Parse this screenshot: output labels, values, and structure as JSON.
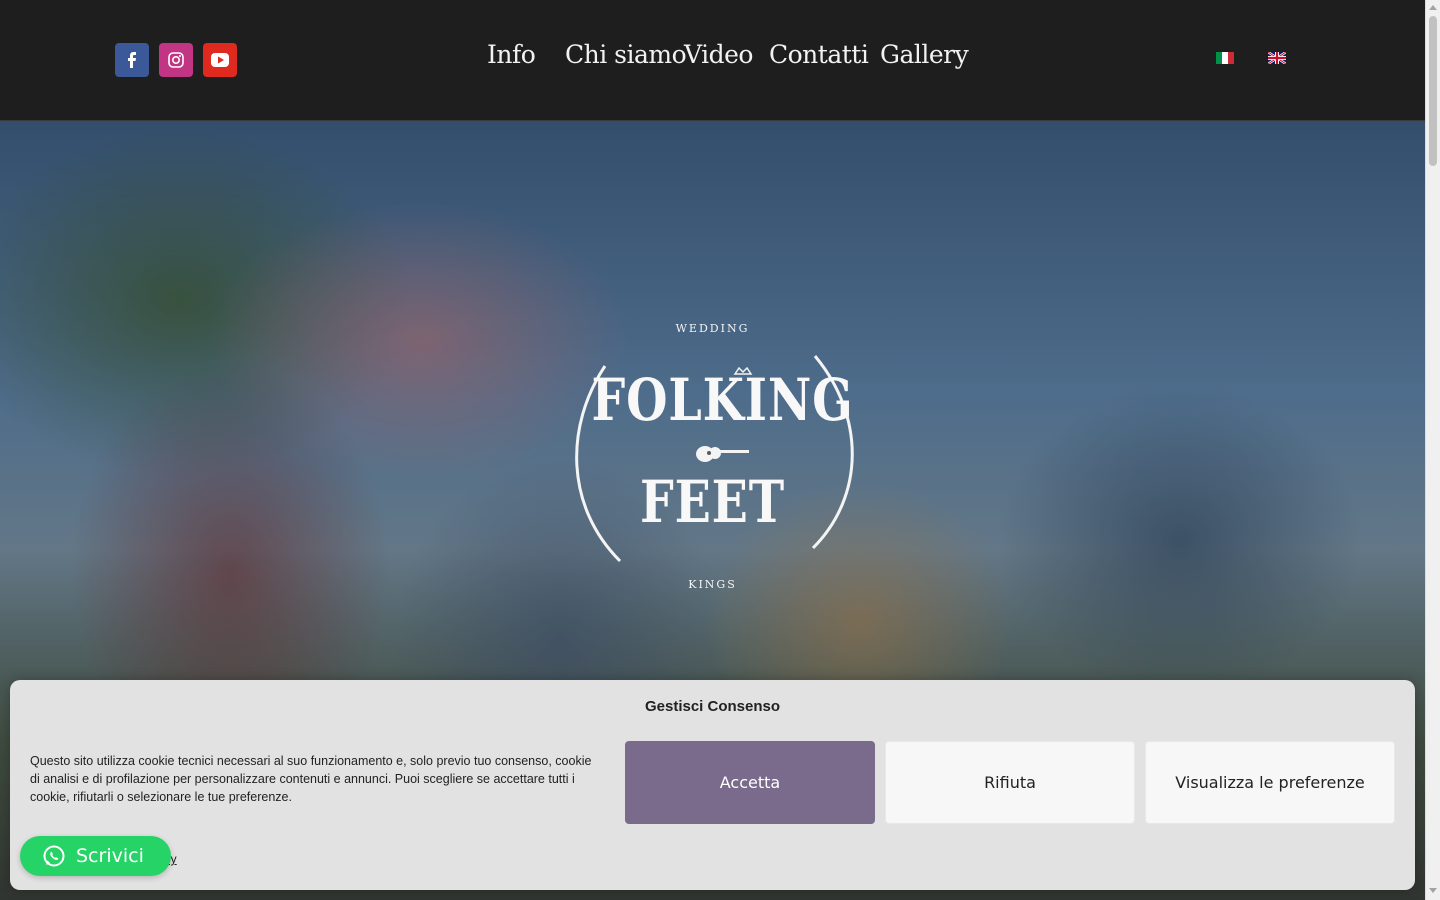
{
  "header": {
    "social": [
      {
        "name": "facebook",
        "icon": "facebook-icon",
        "color": "#3b5998"
      },
      {
        "name": "instagram",
        "icon": "instagram-icon",
        "color": "#c13584"
      },
      {
        "name": "youtube",
        "icon": "youtube-icon",
        "color": "#e02a20"
      }
    ],
    "nav": [
      "Info",
      "Chi siamo",
      "Video",
      "Contatti",
      "Gallery"
    ],
    "languages": [
      {
        "code": "it",
        "icon": "italian-flag-icon"
      },
      {
        "code": "en",
        "icon": "uk-flag-icon"
      }
    ]
  },
  "hero": {
    "logo": {
      "top": "WEDDING",
      "line1": "FOLKING",
      "line2": "FEET",
      "bottom": "KINGS"
    }
  },
  "cookie": {
    "title": "Gestisci Consenso",
    "text": "Questo sito utilizza cookie tecnici necessari al suo funzionamento e, solo previo tuo consenso, cookie di analisi e di profilazione per personalizzare contenuti e annunci. Puoi scegliere se accettare tutti i cookie, rifiutarli o selezionare le tue preferenze.",
    "link": "icy",
    "accept": "Accetta",
    "reject": "Rifiuta",
    "preferences": "Visualizza le preferenze",
    "accent_color": "#7a6a8c"
  },
  "whatsapp": {
    "label": "Scrivici",
    "icon": "whatsapp-icon",
    "color": "#25d366"
  }
}
